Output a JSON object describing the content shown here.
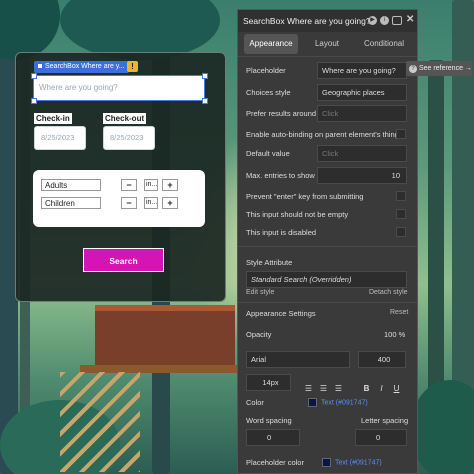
{
  "canvas": {
    "element_label": "SearchBox Where are y...",
    "search_placeholder": "Where are you going?",
    "checkin_label": "Check-in",
    "checkin_value": "8/25/2023",
    "checkout_label": "Check-out",
    "checkout_value": "8/25/2023",
    "guests": [
      {
        "name": "Adults",
        "value": "in..."
      },
      {
        "name": "Children",
        "value": "in..."
      }
    ],
    "minus": "−",
    "plus": "+",
    "search_button": "Search"
  },
  "panel": {
    "title": "SearchBox Where are you going?",
    "tabs": [
      "Appearance",
      "Layout",
      "Conditional"
    ],
    "active_tab": 0,
    "see_reference": "See reference →",
    "placeholder_label": "Placeholder",
    "placeholder_value": "Where are you going?",
    "choices_label": "Choices style",
    "choices_value": "Geographic places",
    "prefer_label": "Prefer results around",
    "prefer_value": "Click",
    "autobind_label": "Enable auto-binding on parent element's thing",
    "default_label": "Default value",
    "default_value": "Click",
    "max_label": "Max. entries to show",
    "max_value": "10",
    "prevent_label": "Prevent \"enter\" key from submitting",
    "not_empty_label": "This input should not be empty",
    "disabled_label": "This input is disabled",
    "style_attr_label": "Style Attribute",
    "style_value": "Standard Search (Overridden)",
    "edit_style": "Edit style",
    "detach_style": "Detach style",
    "appearance_settings": "Appearance Settings",
    "reset": "Reset",
    "opacity_label": "Opacity",
    "opacity_value": "100 %",
    "font_value": "Arial",
    "weight_value": "400",
    "size_value": "14px",
    "color_label": "Color",
    "color_value": "Text (#091747)",
    "word_spacing_label": "Word spacing",
    "letter_spacing_label": "Letter spacing",
    "word_spacing_value": "0",
    "letter_spacing_value": "0",
    "placeholder_color_label": "Placeholder color",
    "placeholder_color_value": "Text (#091747)"
  },
  "colors": {
    "accent": "#3b6fe0",
    "button": "#d514b6",
    "text_color": "#091747"
  }
}
